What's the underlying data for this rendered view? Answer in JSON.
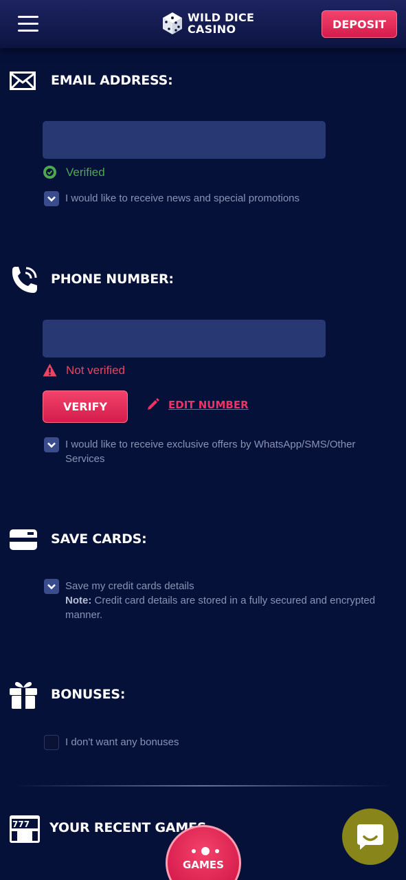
{
  "header": {
    "logo_line1": "WILD DICE",
    "logo_line2": "CASINO",
    "deposit_label": "DEPOSIT"
  },
  "email": {
    "title": "EMAIL ADDRESS:",
    "value": "",
    "status": "Verified",
    "status_color": "#4ea84f",
    "checkbox_label": "I would like to receive news and special promotions",
    "checkbox_checked": true
  },
  "phone": {
    "title": "PHONE NUMBER:",
    "value": "",
    "status": "Not verified",
    "status_color": "#e8455e",
    "verify_label": "VERIFY",
    "edit_label": "EDIT NUMBER",
    "checkbox_label": "I would like to receive exclusive offers by WhatsApp/SMS/Other Services",
    "checkbox_checked": true
  },
  "cards": {
    "title": "SAVE CARDS:",
    "checkbox_label": "Save my credit cards details",
    "note_label": "Note:",
    "note_text": "Credit card details are stored in a fully secured and encrypted manner.",
    "checkbox_checked": true
  },
  "bonuses": {
    "title": "BONUSES:",
    "checkbox_label": "I don't want any bonuses",
    "checkbox_checked": false
  },
  "recent_games": {
    "title": "YOUR RECENT GAMES"
  },
  "bottom": {
    "games_label": "GAMES"
  },
  "colors": {
    "background": "#06113a",
    "accent": "#e8285a",
    "field": "#273873",
    "chat": "#88851a"
  }
}
